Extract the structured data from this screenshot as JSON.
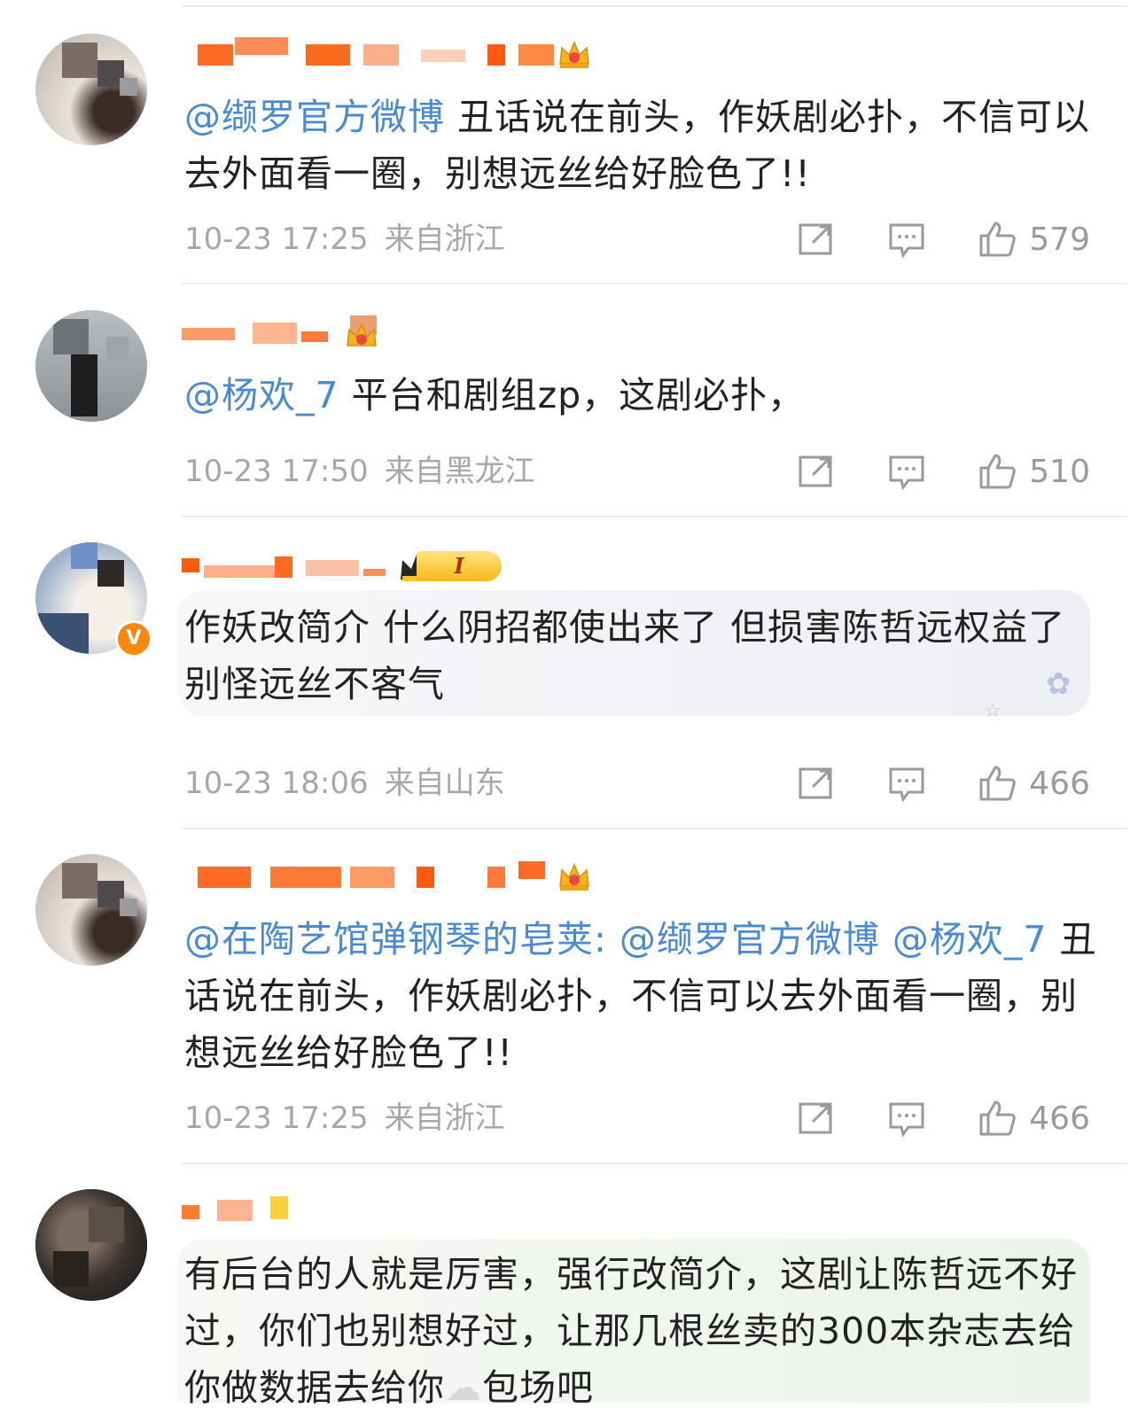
{
  "comments": [
    {
      "mention": "@缬罗官方微博",
      "text": " 丑话说在前头，作妖剧必扑，不信可以去外面看一圈，别想远丝给好脸色了!!",
      "time": "10-23 17:25",
      "region": "来自浙江",
      "likes": "579",
      "has_crown": true
    },
    {
      "mention": "@杨欢_7",
      "text": " 平台和剧组zp，这剧必扑，",
      "time": "10-23 17:50",
      "region": "来自黑龙江",
      "likes": "510",
      "has_crown": true
    },
    {
      "mention": "",
      "text": "作妖改简介 什么阴招都使出来了 但损害陈哲远权益了 别怪远丝不客气",
      "time": "10-23 18:06",
      "region": "来自山东",
      "likes": "466",
      "level_badge": "I",
      "verified_badge": "V"
    },
    {
      "mention": "@在陶艺馆弹钢琴的皂荚:",
      "mention2": "@缬罗官方微博",
      "mention3": "@杨欢_7",
      "text": "丑话说在前头，作妖剧必扑，不信可以去外面看一圈，别想远丝给好脸色了!!",
      "time": "10-23 17:25",
      "region": "来自浙江",
      "likes": "466",
      "has_crown": true
    },
    {
      "mention": "",
      "text": "有后台的人就是厉害，强行改简介，这剧让陈哲远不好过，你们也别想好过，让那几根丝卖的300本杂志去给你做数据去给你",
      "text_tail": "包场吧"
    }
  ],
  "icons": {
    "share": "share-icon",
    "reply": "reply-icon",
    "like": "like-icon",
    "crown": "crown-icon"
  },
  "colors": {
    "mention": "#4a8ad4",
    "meta": "#a7a7a7",
    "divider": "#ececec",
    "vip_orange": "#f7870f"
  }
}
